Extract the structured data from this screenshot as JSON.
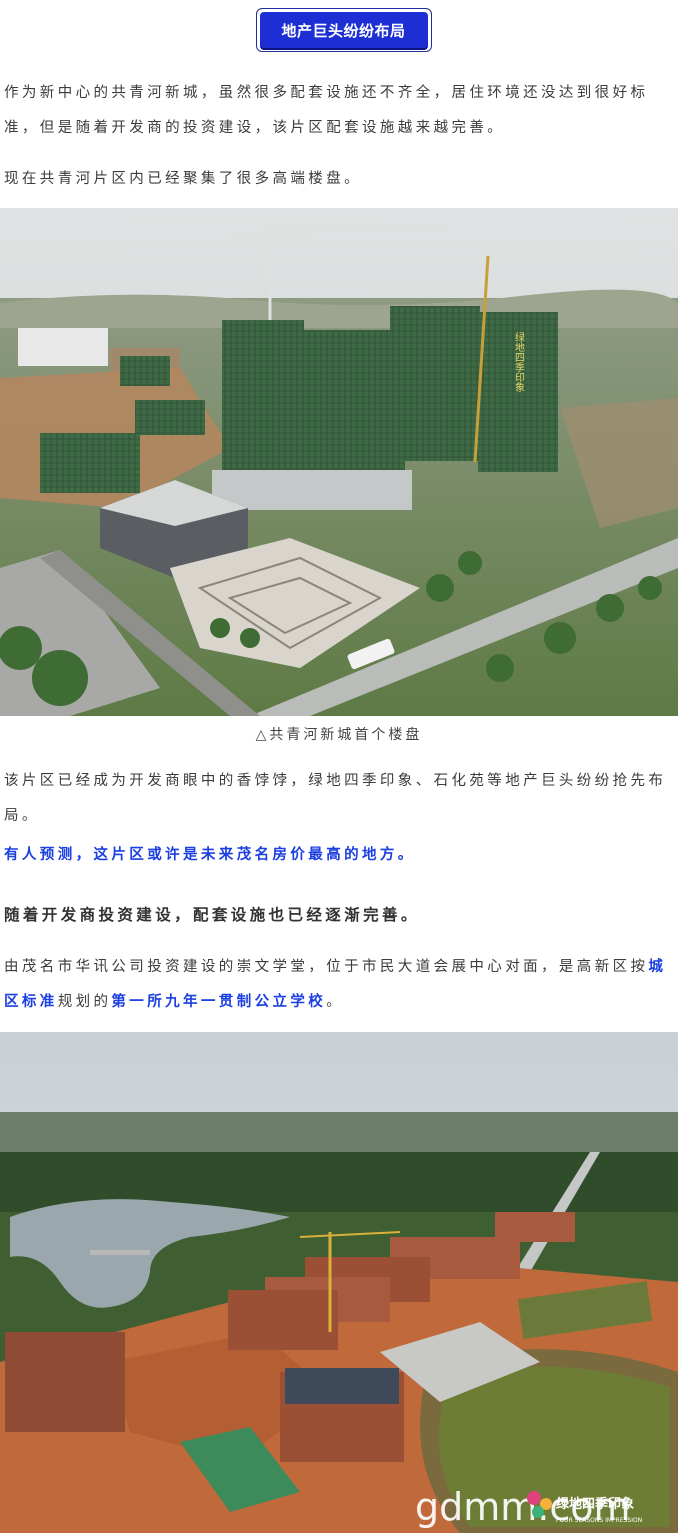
{
  "header": {
    "badge_label": "地产巨头纷纷布局"
  },
  "paragraphs": {
    "p1": "作为新中心的共青河新城，虽然很多配套设施还不齐全，居住环境还没达到很好标准，但是随着开发商的投资建设，该片区配套设施越来越完善。",
    "p2": "现在共青河片区内已经聚集了很多高端楼盘。",
    "p3": "该片区已经成为开发商眼中的香饽饽，绿地四季印象、石化苑等地产巨头纷纷抢先布局。",
    "p4": "有人预测，这片区或许是未来茂名房价最高的地方。",
    "p5": "随着开发商投资建设，配套设施也已经逐渐完善。",
    "p6": {
      "part1": "由茂名市华讯公司投资建设的崇文学堂，位于市民大道会展中心对面，是高新区按",
      "part2": "城区标准",
      "part3": "规划的",
      "part4": "第一所九年一贯制公立学校",
      "part5": "。"
    }
  },
  "photo1": {
    "caption": "△共青河新城首个楼盘",
    "tower_text": "绿地四季印象"
  },
  "photo2": {
    "watermark": "gdmm.com",
    "logo_text": "绿地四季印象",
    "logo_sub": "FOUR SEASONS IMPRESSION"
  },
  "colors": {
    "accent_blue": "#1b3fe0",
    "badge_blue": "#1d2fd4",
    "body_text": "#3c3c3c"
  }
}
